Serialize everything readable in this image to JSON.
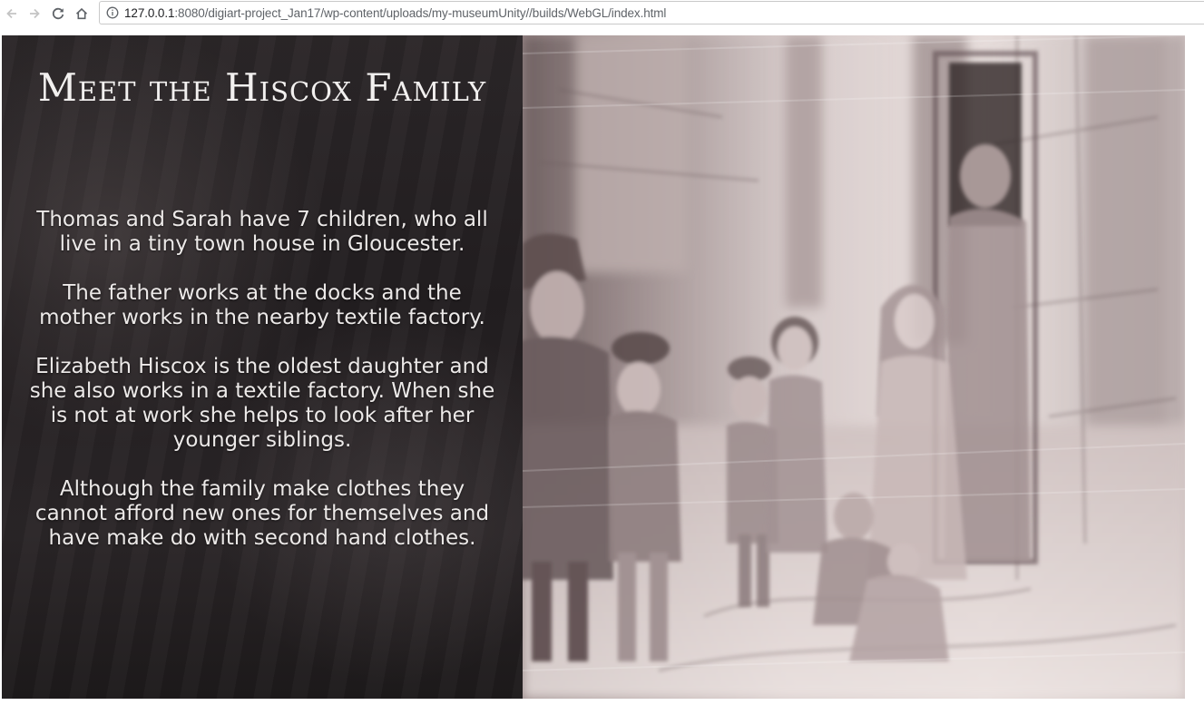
{
  "browser": {
    "icons": {
      "back": "arrow-left-icon",
      "forward": "arrow-right-icon",
      "reload": "reload-icon",
      "home": "home-icon",
      "info": "info-icon"
    },
    "url_host": "127.0.0.1",
    "url_rest": ":8080/digiart-project_Jan17/wp-content/uploads/my-museumUnity//builds/WebGL/index.html"
  },
  "panel": {
    "title": "Meet the Hiscox Family",
    "paragraphs": [
      "Thomas and Sarah have 7 children, who all live in a tiny town house in Gloucester.",
      "The father works at the docks and the mother works in the nearby textile factory.",
      "Elizabeth Hiscox is the oldest daughter and she also works in a textile factory. When she is not at work she helps to look after her younger siblings.",
      "Although the family make clothes they cannot afford new ones for themselves and have make do with second hand clothes."
    ]
  },
  "colors": {
    "panel_bg": "#241f21",
    "panel_text": "#ece9e8",
    "sketch_tone": "#d8cccb"
  }
}
